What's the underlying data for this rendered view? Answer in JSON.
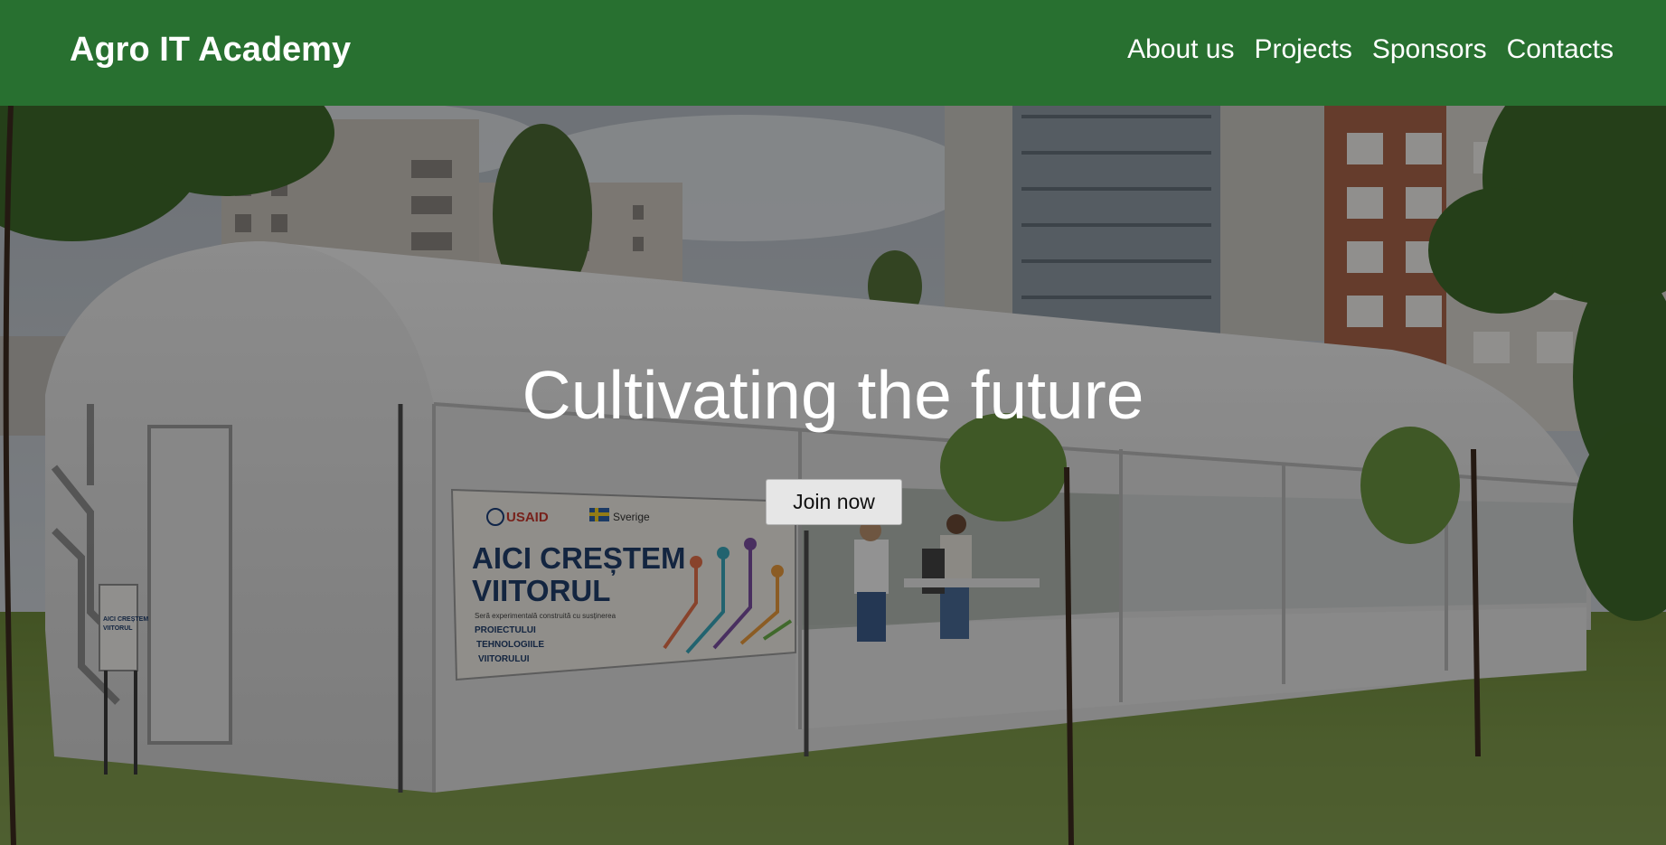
{
  "header": {
    "brand": "Agro IT Academy",
    "nav": [
      {
        "label": "About us"
      },
      {
        "label": "Projects"
      },
      {
        "label": "Sponsors"
      },
      {
        "label": "Contacts"
      }
    ],
    "background_color": "#287030"
  },
  "hero": {
    "headline": "Cultivating the future",
    "button_label": "Join now",
    "banner": {
      "logo_text": "USAID",
      "country_text": "Sverige",
      "title_line1": "AICI CREȘTEM",
      "title_line2": "VIITORUL",
      "small_text": "Seră experimentală construită cu susținerea",
      "list_line1": "PROIECTULUI",
      "list_line2": "TEHNOLOGIILE",
      "list_line3": "VIITORULUI"
    },
    "side_sign": {
      "line1": "AICI CREȘTEM",
      "line2": "VIITORUL"
    }
  }
}
